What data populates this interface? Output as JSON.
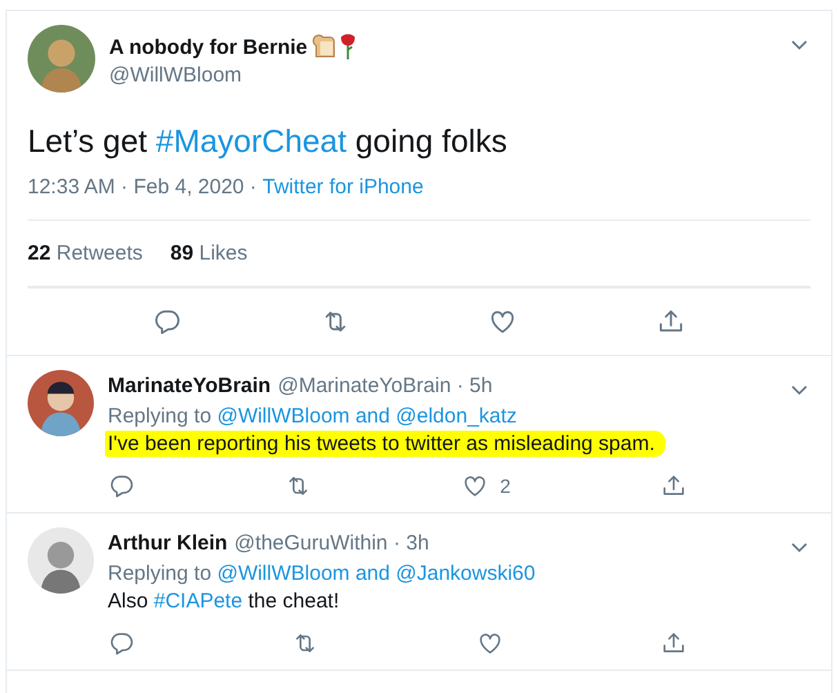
{
  "tweet": {
    "name": "A nobody for Bernie",
    "handle": "@WillWBloom",
    "text": [
      {
        "kind": "plain",
        "text": "Let’s get "
      },
      {
        "kind": "hashtag",
        "text": "#MayorCheat"
      },
      {
        "kind": "plain",
        "text": " going folks"
      }
    ],
    "time": "12:33 AM · Feb 4, 2020 · ",
    "source": "Twitter for iPhone",
    "stats": [
      {
        "count": "22",
        "label": "Retweets"
      },
      {
        "count": "89",
        "label": "Likes"
      }
    ]
  },
  "replies": [
    {
      "name": "MarinateYoBrain",
      "meta": "@MarinateYoBrain · 5h",
      "replying": "Replying to ",
      "mentions": "@WillWBloom and @eldon_katz",
      "text": [
        {
          "kind": "plain",
          "text": "I've been reporting his tweets to twitter as misleading spam."
        }
      ],
      "highlighted": true,
      "likes": "2"
    },
    {
      "name": "Arthur Klein",
      "meta": "@theGuruWithin · 3h",
      "replying": "Replying to ",
      "mentions": "@WillWBloom and @Jankowski60",
      "text": [
        {
          "kind": "plain",
          "text": "Also "
        },
        {
          "kind": "hashtag",
          "text": "#CIAPete"
        },
        {
          "kind": "plain",
          "text": " the cheat!"
        }
      ],
      "highlighted": false
    }
  ]
}
